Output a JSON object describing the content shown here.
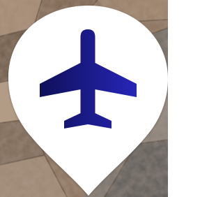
{
  "map_marker": {
    "kind": "airport",
    "icon": "airplane-icon",
    "colors": {
      "pin_fill": "#FFFFFF",
      "icon_gradient_start": "#0F0F5A",
      "icon_gradient_end": "#2626B8"
    }
  },
  "background": {
    "description_visual": "stone-wall-texture",
    "colors": [
      "#8A6E58",
      "#A88C74",
      "#6F6A66",
      "#B9A894",
      "#5E4C3E"
    ]
  }
}
